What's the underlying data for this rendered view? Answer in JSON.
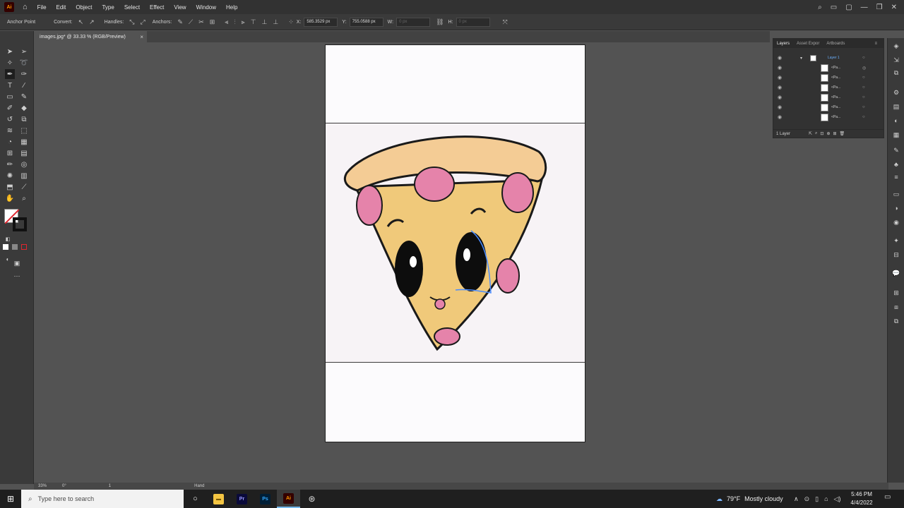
{
  "app": {
    "logo": "Ai"
  },
  "menu": [
    "File",
    "Edit",
    "Object",
    "Type",
    "Select",
    "Effect",
    "View",
    "Window",
    "Help"
  ],
  "controlbar": {
    "tool_name": "Anchor Point",
    "convert_label": "Convert:",
    "handles_label": "Handles:",
    "anchors_label": "Anchors:",
    "x_label": "X:",
    "x_value": "585.3529 px",
    "y_label": "Y:",
    "y_value": "755.0588 px",
    "w_label": "W:",
    "w_value": "0 px",
    "h_label": "H:",
    "h_value": "0 px"
  },
  "document_tab": {
    "title": "images.jpg* @ 33.33 % (RGB/Preview)",
    "close": "×"
  },
  "statusbar": {
    "zoom": "33%",
    "rotation": "0°",
    "artboard": "1",
    "tool": "Hand"
  },
  "layers_panel": {
    "tabs": [
      "Layers",
      "Asset Expor",
      "Artboards"
    ],
    "top_layer": "Layer 1",
    "items": [
      "<Pa...",
      "<Pa...",
      "<Pa...",
      "<Pa...",
      "<Pa...",
      "<Pa..."
    ],
    "footer": "1 Layer"
  },
  "taskbar": {
    "search_placeholder": "Type here to search",
    "weather_temp": "79°F",
    "weather_text": "Mostly cloudy",
    "time": "5:46 PM",
    "date": "4/4/2022",
    "apps": [
      "Pr",
      "Ps",
      "Ai"
    ]
  },
  "colors": {
    "brand_ai": "#ff9a00",
    "selection_blue": "#4a8cff",
    "pizza_crust": "#f1c27d",
    "pepperoni": "#e27aa3"
  }
}
